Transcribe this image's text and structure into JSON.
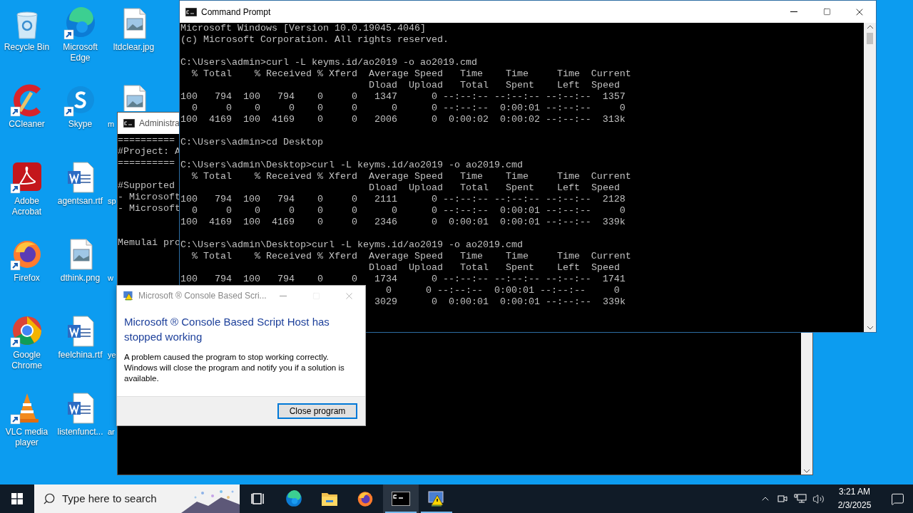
{
  "desktop_icons": [
    {
      "label": "Recycle Bin",
      "kind": "recycle",
      "shortcut": false
    },
    {
      "label": "CCleaner",
      "kind": "ccleaner",
      "shortcut": true
    },
    {
      "label": "Adobe Acrobat",
      "kind": "pdf",
      "shortcut": true
    },
    {
      "label": "Firefox",
      "kind": "firefox",
      "shortcut": true
    },
    {
      "label": "Google Chrome",
      "kind": "chrome",
      "shortcut": true
    },
    {
      "label": "VLC media player",
      "kind": "vlc",
      "shortcut": true
    },
    {
      "label": "Microsoft Edge",
      "kind": "edge",
      "shortcut": true
    },
    {
      "label": "Skype",
      "kind": "skype",
      "shortcut": true
    },
    {
      "label": "agentsan.rtf",
      "kind": "word",
      "shortcut": false
    },
    {
      "label": "dthink.png",
      "kind": "image",
      "shortcut": false
    },
    {
      "label": "feelchina.rtf",
      "kind": "word",
      "shortcut": false
    },
    {
      "label": "listenfunct...",
      "kind": "word",
      "shortcut": false
    },
    {
      "label": "ltdclear.jpg",
      "kind": "image",
      "shortcut": false
    },
    {
      "label": "m",
      "kind": "image",
      "shortcut": false,
      "cut_off": true
    },
    {
      "label": "sp",
      "kind": "covered",
      "shortcut": false
    },
    {
      "label": "w",
      "kind": "covered",
      "shortcut": false
    },
    {
      "label": "ye",
      "kind": "covered",
      "shortcut": false
    },
    {
      "label": "ar",
      "kind": "covered",
      "shortcut": false
    }
  ],
  "admin_window": {
    "title": "Administra",
    "lines": [
      {
        "kind": "text",
        "text": "=========="
      },
      {
        "kind": "text",
        "text": "#Project: A"
      },
      {
        "kind": "text",
        "text": "=========="
      },
      {
        "kind": "blank"
      },
      {
        "kind": "text",
        "text": "#Supported"
      },
      {
        "kind": "text",
        "text": "- Microsoft"
      },
      {
        "kind": "text",
        "text": "- Microsoft"
      },
      {
        "kind": "blank"
      },
      {
        "kind": "blank"
      },
      {
        "kind": "text",
        "text": "Memulai pro"
      }
    ]
  },
  "cmd_window": {
    "title": "Command Prompt",
    "lines": [
      {
        "kind": "text",
        "text": "Microsoft Windows [Version 10.0.19045.4046]"
      },
      {
        "kind": "text",
        "text": "(c) Microsoft Corporation. All rights reserved."
      },
      {
        "kind": "blank"
      },
      {
        "kind": "text",
        "text": "C:\\Users\\admin>curl -L keyms.id/ao2019 -o ao2019.cmd"
      },
      {
        "kind": "text",
        "text": "  % Total    % Received % Xferd  Average Speed   Time    Time     Time  Current"
      },
      {
        "kind": "text",
        "text": "                                 Dload  Upload   Total   Spent    Left  Speed"
      },
      {
        "kind": "text",
        "text": "100   794  100   794    0     0   1347      0 --:--:-- --:--:-- --:--:--  1357"
      },
      {
        "kind": "text",
        "text": "  0     0    0     0    0     0      0      0 --:--:--  0:00:01 --:--:--     0"
      },
      {
        "kind": "text",
        "text": "100  4169  100  4169    0     0   2006      0  0:00:02  0:00:02 --:--:--  313k"
      },
      {
        "kind": "blank"
      },
      {
        "kind": "text",
        "text": "C:\\Users\\admin>cd Desktop"
      },
      {
        "kind": "blank"
      },
      {
        "kind": "text",
        "text": "C:\\Users\\admin\\Desktop>curl -L keyms.id/ao2019 -o ao2019.cmd"
      },
      {
        "kind": "text",
        "text": "  % Total    % Received % Xferd  Average Speed   Time    Time     Time  Current"
      },
      {
        "kind": "text",
        "text": "                                 Dload  Upload   Total   Spent    Left  Speed"
      },
      {
        "kind": "text",
        "text": "100   794  100   794    0     0   2111      0 --:--:-- --:--:-- --:--:--  2128"
      },
      {
        "kind": "text",
        "text": "  0     0    0     0    0     0      0      0 --:--:--  0:00:01 --:--:--     0"
      },
      {
        "kind": "text",
        "text": "100  4169  100  4169    0     0   2346      0  0:00:01  0:00:01 --:--:--  339k"
      },
      {
        "kind": "blank"
      },
      {
        "kind": "text",
        "text": "C:\\Users\\admin\\Desktop>curl -L keyms.id/ao2019 -o ao2019.cmd"
      },
      {
        "kind": "text",
        "text": "  % Total    % Received % Xferd  Average Speed   Time    Time     Time  Current"
      },
      {
        "kind": "text",
        "text": "                                 Dload  Upload   Total   Spent    Left  Speed"
      },
      {
        "kind": "text",
        "text": "100   794  100   794    0     0   1734      0 --:--:-- --:--:-- --:--:--  1741"
      },
      {
        "kind": "text",
        "text": "                                    0      0 --:--:--  0:00:01 --:--:--     0"
      },
      {
        "kind": "text",
        "text": "                                  3029      0  0:00:01  0:00:01 --:--:--  339k"
      }
    ]
  },
  "error_dialog": {
    "title": "Microsoft ® Console Based Scri...",
    "heading": "Microsoft ® Console Based Script Host has stopped working",
    "message": "A problem caused the program to stop working correctly. Windows will close the program and notify you if a solution is available.",
    "button": "Close program"
  },
  "taskbar": {
    "search": {
      "placeholder": "Type here to search"
    },
    "apps": [
      {
        "kind": "taskview",
        "running": false,
        "selected": false
      },
      {
        "kind": "edge",
        "running": false,
        "selected": false
      },
      {
        "kind": "explorer",
        "running": false,
        "selected": false
      },
      {
        "kind": "firefox",
        "running": false,
        "selected": false
      },
      {
        "kind": "cmd",
        "running": true,
        "selected": true
      },
      {
        "kind": "scripthost",
        "running": true,
        "selected": false
      }
    ],
    "clock": {
      "time": "3:21 AM",
      "date": "2/3/2025"
    }
  }
}
